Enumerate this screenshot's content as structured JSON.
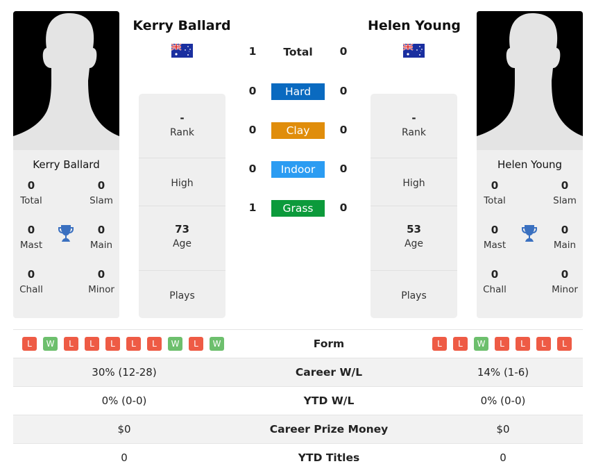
{
  "player1": {
    "name": "Kerry Ballard",
    "country_flag": "australia-flag",
    "titles": {
      "total": {
        "value": "0",
        "label": "Total"
      },
      "slam": {
        "value": "0",
        "label": "Slam"
      },
      "mast": {
        "value": "0",
        "label": "Mast"
      },
      "main": {
        "value": "0",
        "label": "Main"
      },
      "chall": {
        "value": "0",
        "label": "Chall"
      },
      "minor": {
        "value": "0",
        "label": "Minor"
      }
    },
    "info": {
      "rank": {
        "value": "-",
        "label": "Rank"
      },
      "high": {
        "value": "",
        "label": "High"
      },
      "age": {
        "value": "73",
        "label": "Age"
      },
      "plays": {
        "value": "",
        "label": "Plays"
      }
    },
    "form": [
      "L",
      "W",
      "L",
      "L",
      "L",
      "L",
      "L",
      "W",
      "L",
      "W"
    ],
    "career_wl": "30% (12-28)",
    "ytd_wl": "0% (0-0)",
    "career_prize": "$0",
    "ytd_titles": "0"
  },
  "player2": {
    "name": "Helen Young",
    "country_flag": "australia-flag",
    "titles": {
      "total": {
        "value": "0",
        "label": "Total"
      },
      "slam": {
        "value": "0",
        "label": "Slam"
      },
      "mast": {
        "value": "0",
        "label": "Mast"
      },
      "main": {
        "value": "0",
        "label": "Main"
      },
      "chall": {
        "value": "0",
        "label": "Chall"
      },
      "minor": {
        "value": "0",
        "label": "Minor"
      }
    },
    "info": {
      "rank": {
        "value": "-",
        "label": "Rank"
      },
      "high": {
        "value": "",
        "label": "High"
      },
      "age": {
        "value": "53",
        "label": "Age"
      },
      "plays": {
        "value": "",
        "label": "Plays"
      }
    },
    "form": [
      "L",
      "L",
      "W",
      "L",
      "L",
      "L",
      "L"
    ],
    "career_wl": "14% (1-6)",
    "ytd_wl": "0% (0-0)",
    "career_prize": "$0",
    "ytd_titles": "0"
  },
  "h2h": [
    {
      "label": "Total",
      "p1": "1",
      "p2": "0",
      "color": ""
    },
    {
      "label": "Hard",
      "p1": "0",
      "p2": "0",
      "color": "#0a6ac0"
    },
    {
      "label": "Clay",
      "p1": "0",
      "p2": "0",
      "color": "#e08d0b"
    },
    {
      "label": "Indoor",
      "p1": "0",
      "p2": "0",
      "color": "#2b9cf2"
    },
    {
      "label": "Grass",
      "p1": "1",
      "p2": "0",
      "color": "#0c9a3b"
    }
  ],
  "table_labels": {
    "form": "Form",
    "career_wl": "Career W/L",
    "ytd_wl": "YTD W/L",
    "career_prize": "Career Prize Money",
    "ytd_titles": "YTD Titles"
  },
  "colors": {
    "loss": "#ee5b45",
    "win": "#6dbf6d",
    "trophy": "#3a70c0"
  }
}
